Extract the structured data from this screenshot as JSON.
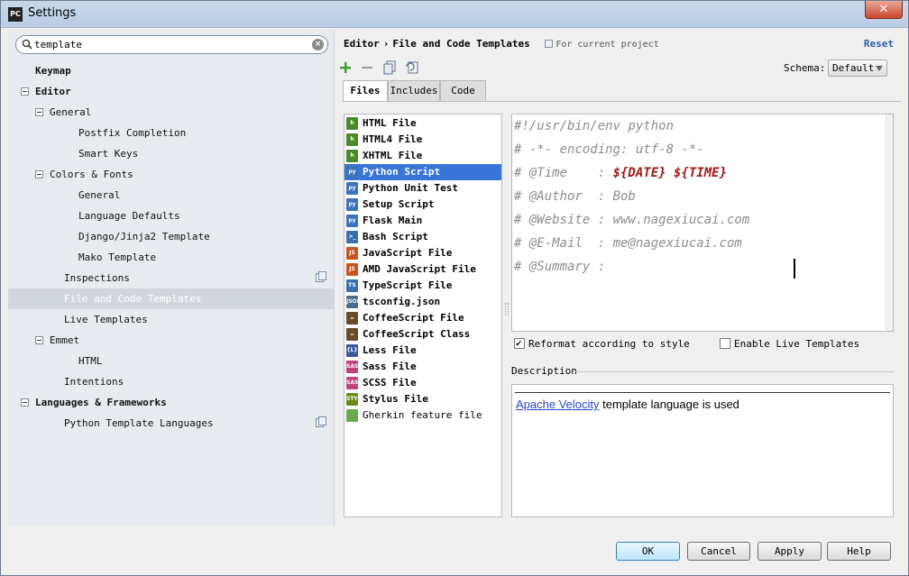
{
  "window": {
    "title": "Settings",
    "app_icon": "PC",
    "close_glyph": "✕"
  },
  "search": {
    "value": "template",
    "placeholder": ""
  },
  "tree": [
    {
      "label": "Keymap",
      "bold": true,
      "indent": 0,
      "toggle": false
    },
    {
      "label": "Editor",
      "bold": true,
      "indent": 0,
      "toggle": true
    },
    {
      "label": "General",
      "bold": false,
      "indent": 1,
      "toggle": true
    },
    {
      "label": "Postfix Completion",
      "bold": false,
      "indent": 3,
      "toggle": false
    },
    {
      "label": "Smart Keys",
      "bold": false,
      "indent": 3,
      "toggle": false
    },
    {
      "label": "Colors & Fonts",
      "bold": false,
      "indent": 1,
      "toggle": true
    },
    {
      "label": "General",
      "bold": false,
      "indent": 3,
      "toggle": false
    },
    {
      "label": "Language Defaults",
      "bold": false,
      "indent": 3,
      "toggle": false
    },
    {
      "label": "Django/Jinja2 Template",
      "bold": false,
      "indent": 3,
      "toggle": false
    },
    {
      "label": "Mako Template",
      "bold": false,
      "indent": 3,
      "toggle": false
    },
    {
      "label": "Inspections",
      "bold": false,
      "indent": 2,
      "toggle": false,
      "copy_icon": true
    },
    {
      "label": "File and Code Templates",
      "bold": false,
      "indent": 2,
      "toggle": false,
      "selected": true
    },
    {
      "label": "Live Templates",
      "bold": false,
      "indent": 2,
      "toggle": false
    },
    {
      "label": "Emmet",
      "bold": false,
      "indent": 1,
      "toggle": true
    },
    {
      "label": "HTML",
      "bold": false,
      "indent": 3,
      "toggle": false
    },
    {
      "label": "Intentions",
      "bold": false,
      "indent": 2,
      "toggle": false
    },
    {
      "label": "Languages & Frameworks",
      "bold": true,
      "indent": 0,
      "toggle": true
    },
    {
      "label": "Python Template Languages",
      "bold": false,
      "indent": 2,
      "toggle": false,
      "copy_icon": true
    }
  ],
  "header": {
    "breadcrumb_editor": "Editor",
    "breadcrumb_sep": "›",
    "breadcrumb_page": "File and Code Templates",
    "scope": "For current project",
    "reset": "Reset"
  },
  "schema": {
    "label": "Schema:",
    "value": "Default"
  },
  "tabs": [
    "Files",
    "Includes",
    "Code"
  ],
  "files": [
    {
      "name": "HTML File",
      "icon": "html-file-icon",
      "badge": "h",
      "color": "#4b8a2a"
    },
    {
      "name": "HTML4 File",
      "icon": "html-file-icon",
      "badge": "h",
      "color": "#4b8a2a"
    },
    {
      "name": "XHTML File",
      "icon": "html-file-icon",
      "badge": "h",
      "color": "#4b8a2a"
    },
    {
      "name": "Python Script",
      "icon": "python-icon",
      "badge": "py",
      "color": "#3b73b9",
      "selected": true
    },
    {
      "name": "Python Unit Test",
      "icon": "python-icon",
      "badge": "py",
      "color": "#3b73b9"
    },
    {
      "name": "Setup Script",
      "icon": "python-icon",
      "badge": "py",
      "color": "#3b73b9"
    },
    {
      "name": "Flask Main",
      "icon": "python-icon",
      "badge": "py",
      "color": "#3b73b9"
    },
    {
      "name": "Bash Script",
      "icon": "terminal-icon",
      "badge": ">_",
      "color": "#3a6fb0"
    },
    {
      "name": "JavaScript File",
      "icon": "javascript-icon",
      "badge": "JS",
      "color": "#c8561e"
    },
    {
      "name": "AMD JavaScript File",
      "icon": "javascript-icon",
      "badge": "JS",
      "color": "#c8561e"
    },
    {
      "name": "TypeScript File",
      "icon": "typescript-icon",
      "badge": "TS",
      "color": "#3a6fb0"
    },
    {
      "name": "tsconfig.json",
      "icon": "json-icon",
      "badge": "JSON",
      "color": "#4a6b8a"
    },
    {
      "name": "CoffeeScript File",
      "icon": "coffee-icon",
      "badge": "☕",
      "color": "#6a4a2a"
    },
    {
      "name": "CoffeeScript Class",
      "icon": "coffee-icon",
      "badge": "☕",
      "color": "#6a4a2a"
    },
    {
      "name": "Less File",
      "icon": "less-icon",
      "badge": "{L}",
      "color": "#3a5a9a"
    },
    {
      "name": "Sass File",
      "icon": "sass-icon",
      "badge": "SASS",
      "color": "#c0437a"
    },
    {
      "name": "SCSS File",
      "icon": "scss-icon",
      "badge": "SASS",
      "color": "#c0437a"
    },
    {
      "name": "Stylus File",
      "icon": "stylus-icon",
      "badge": "STYL",
      "color": "#6b8a1a"
    },
    {
      "name": "Gherkin feature file",
      "icon": "gherkin-icon",
      "badge": "",
      "color": "#6aa84f",
      "plain": true
    }
  ],
  "editor": {
    "lines": [
      {
        "text": "#!/usr/bin/env python",
        "var": ""
      },
      {
        "text": "# -*- encoding: utf-8 -*-",
        "var": ""
      },
      {
        "text": "# @Time    : ",
        "var": "${DATE} ${TIME}"
      },
      {
        "text": "# @Author  : Bob",
        "var": ""
      },
      {
        "text": "# @Website : www.nagexiucai.com",
        "var": ""
      },
      {
        "text": "# @E-Mail  : me@nagexiucai.com",
        "var": ""
      },
      {
        "text": "# @Summary : ",
        "var": ""
      }
    ]
  },
  "options": {
    "reformat": {
      "label": "Reformat according to style",
      "checked": true
    },
    "live_templates": {
      "label": "Enable Live Templates",
      "checked": false
    }
  },
  "description": {
    "title": "Description",
    "link": "Apache Velocity",
    "text": " template language is used"
  },
  "buttons": {
    "ok": "OK",
    "cancel": "Cancel",
    "apply": "Apply",
    "help": "Help"
  },
  "colors": {
    "selection": "#3875d7",
    "accent": "#2a5dab",
    "template_var": "#a01818"
  }
}
